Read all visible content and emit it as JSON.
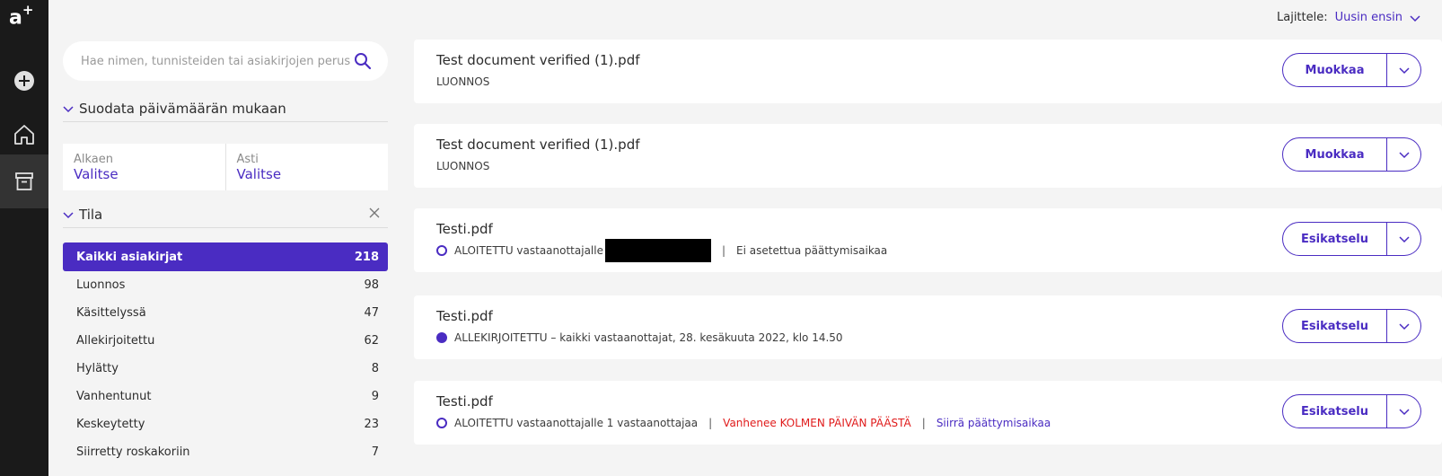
{
  "rail": {
    "logo": "a",
    "logo_sup": "+"
  },
  "search": {
    "placeholder": "Hae nimen, tunnisteiden tai asiakirjojen perust"
  },
  "date_filter": {
    "heading": "Suodata päivämäärän mukaan",
    "from_label": "Alkaen",
    "from_value": "Valitse",
    "to_label": "Asti",
    "to_value": "Valitse"
  },
  "status_filter": {
    "heading": "Tila",
    "items": [
      {
        "label": "Kaikki asiakirjat",
        "count": "218"
      },
      {
        "label": "Luonnos",
        "count": "98"
      },
      {
        "label": "Käsittelyssä",
        "count": "47"
      },
      {
        "label": "Allekirjoitettu",
        "count": "62"
      },
      {
        "label": "Hylätty",
        "count": "8"
      },
      {
        "label": "Vanhentunut",
        "count": "9"
      },
      {
        "label": "Keskeytetty",
        "count": "23"
      },
      {
        "label": "Siirretty roskakoriin",
        "count": "7"
      }
    ]
  },
  "sort": {
    "label": "Lajittele:",
    "value": "Uusin ensin"
  },
  "documents": [
    {
      "title": "Test document verified (1).pdf",
      "status": "LUONNOS",
      "button": "Muokkaa"
    },
    {
      "title": "Test document verified (1).pdf",
      "status": "LUONNOS",
      "button": "Muokkaa"
    },
    {
      "title": "Testi.pdf",
      "status": "ALOITETTU vastaanottajalle",
      "deadline": "Ei asetettua päättymisaikaa",
      "button": "Esikatselu"
    },
    {
      "title": "Testi.pdf",
      "status": "ALLEKIRJOITETTU – kaikki vastaanottajat, 28. kesäkuuta 2022, klo 14.50",
      "button": "Esikatselu"
    },
    {
      "title": "Testi.pdf",
      "status": "ALOITETTU vastaanottajalle 1 vastaanottajaa",
      "warning": "Vanhenee KOLMEN PÄIVÄN PÄÄSTÄ",
      "action": "Siirrä päättymisaikaa",
      "button": "Esikatselu"
    }
  ],
  "colors": {
    "accent": "#4a2cc2",
    "rail": "#1a1a1a",
    "warning": "#e01b1b"
  }
}
